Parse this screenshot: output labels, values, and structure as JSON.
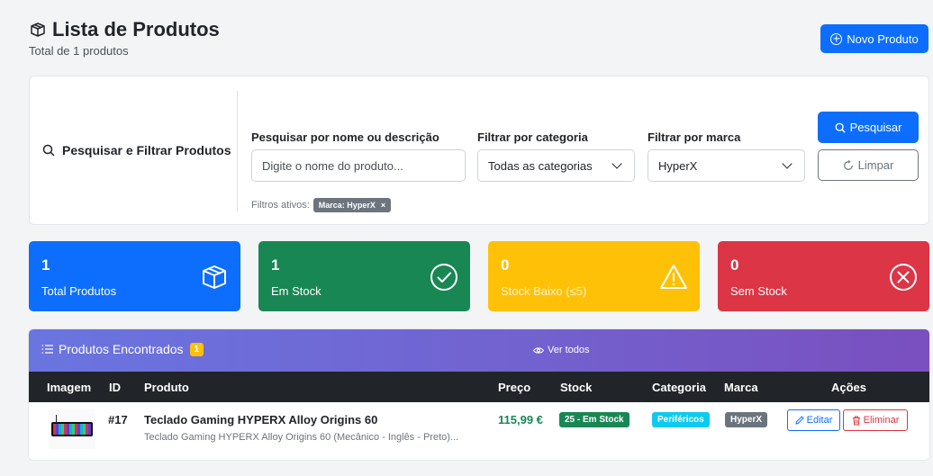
{
  "header": {
    "title": "Lista de Produtos",
    "subtitle": "Total de 1 produtos",
    "new_button": "Novo Produto",
    "title_icon": "box-icon",
    "new_icon": "plus-circle-icon"
  },
  "filters": {
    "heading": "Pesquisar e Filtrar Produtos",
    "search_label": "Pesquisar por nome ou descrição",
    "search_placeholder": "Digite o nome do produto...",
    "category_label": "Filtrar por categoria",
    "category_value": "Todas as categorias",
    "brand_label": "Filtrar por marca",
    "brand_value": "HyperX",
    "search_button": "Pesquisar",
    "clear_button": "Limpar",
    "active_label": "Filtros ativos:",
    "active_badge": "Marca: HyperX",
    "active_badge_close": "×"
  },
  "stats": [
    {
      "value": "1",
      "label": "Total Produtos",
      "color": "#0d6efd",
      "icon": "box-icon"
    },
    {
      "value": "1",
      "label": "Em Stock",
      "color": "#198754",
      "icon": "check-circle-icon"
    },
    {
      "value": "0",
      "label": "Stock Baixo (≤5)",
      "color": "#ffc107",
      "icon": "warning-icon"
    },
    {
      "value": "0",
      "label": "Sem Stock",
      "color": "#dc3545",
      "icon": "x-circle-icon"
    }
  ],
  "products": {
    "title": "Produtos Encontrados",
    "count": "1",
    "view_all": "Ver todos",
    "columns": [
      "Imagem",
      "ID",
      "Produto",
      "Preço",
      "Stock",
      "Categoria",
      "Marca",
      "Ações"
    ],
    "rows": [
      {
        "id": "#17",
        "name": "Teclado Gaming HYPERX Alloy Origins 60",
        "description": "Teclado Gaming HYPERX Alloy Origins 60 (Mecânico - Inglês - Preto)...",
        "price": "115,99 €",
        "stock": "25 - Em Stock",
        "category": "Periféricos",
        "brand": "HyperX",
        "edit": "Editar",
        "delete": "Eliminar"
      }
    ]
  },
  "colors": {
    "primary": "#0d6efd",
    "success": "#198754",
    "warning": "#ffc107",
    "danger": "#dc3545",
    "info": "#0dcaf0",
    "secondary": "#6c757d"
  }
}
